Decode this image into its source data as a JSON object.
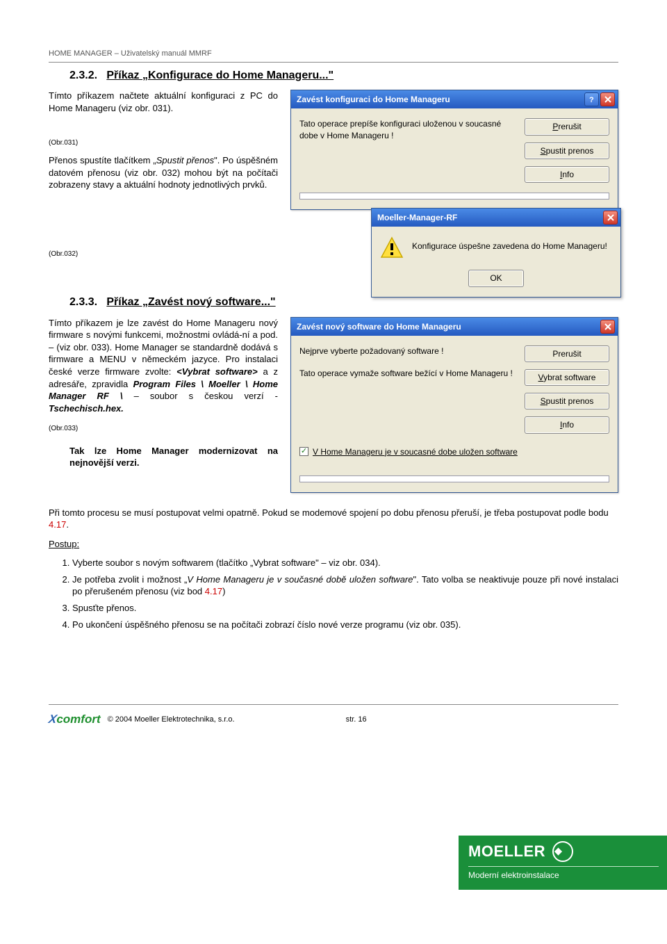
{
  "header": {
    "text": "HOME MANAGER – Uživatelský manuál  MMRF"
  },
  "s1": {
    "num": "2.3.2.",
    "title": "Příkaz „Konfigurace do Home Manageru...\"",
    "p1": "Tímto příkazem načtete aktuální konfiguraci z PC do Home Manageru (viz obr. 031).",
    "capt031": "(Obr.031)",
    "p2a": "Přenos spustíte tlačítkem „",
    "p2b": "Spustit přenos",
    "p2c": "\". Po úspěšném datovém přenosu (viz obr. 032) mohou být na počítači zobrazeny stavy a aktuální hodnoty jednotlivých prvků.",
    "capt032": "(Obr.032)"
  },
  "dlg1": {
    "title": "Zavést konfiguraci do Home Manageru",
    "msg": "Tato operace prepíše konfiguraci uloženou v soucasné dobe v Home Manageru !",
    "btn_cancel": "Prerušit",
    "btn_start": "Spustit prenos",
    "btn_info": "Info"
  },
  "dlg2": {
    "title": "Moeller-Manager-RF",
    "msg": "Konfigurace úspešne zavedena do Home Manageru!",
    "ok": "OK"
  },
  "s2": {
    "num": "2.3.3.",
    "title": "Příkaz „Zavést nový software...\"",
    "p1": "Tímto příkazem je lze zavést do Home Manageru nový firmware s novými funkcemi, možnostmi ovládá-ní a pod. – (viz obr. 033). Home Manager se standardně dodává s firmware a MENU v německém jazyce. Pro instalaci české verze firmware zvolte: ",
    "p1b": "<Vybrat software>",
    "p1c": " a z adresáře, zpravidla ",
    "p1d": "Program Files \\ Moeller \\ Home Manager RF \\",
    "p1e": " – soubor s českou verzí - ",
    "p1f": "Tschechisch.hex.",
    "capt033": "(Obr.033)",
    "p2": "Tak lze Home Manager modernizovat na nejnovější verzi.",
    "p3a": "Při tomto procesu se musí postupovat velmi opatrně. Pokud se modemové spojení po dobu přenosu přeruší, je třeba postupovat podle bodu ",
    "p3b": "4.17",
    "p3c": ".",
    "postup": "Postup:",
    "li1": "Vyberte soubor s novým softwarem (tlačítko „Vybrat software\" – viz obr. 034).",
    "li2a": "Je potřeba zvolit i možnost „",
    "li2b": "V Home Manageru je v současné době uložen software",
    "li2c": "\". Tato volba se neaktivuje pouze  při nové instalaci po přerušeném přenosu (viz bod ",
    "li2d": "4.17",
    "li2e": ")",
    "li3": "Spusťte přenos.",
    "li4": "Po ukončení úspěšného přenosu se na počítači zobrazí číslo nové verze programu (viz obr. 035)."
  },
  "dlg3": {
    "title": "Zavést nový software do Home Manageru",
    "msg1": "Nejprve vyberte požadovaný software !",
    "msg2": "Tato operace vymaže software bežící v Home Manageru !",
    "btn_cancel": "Prerušit",
    "btn_select": "Vybrat software",
    "btn_start": "Spustit prenos",
    "btn_info": "Info",
    "checkbox": "V Home Manageru je v soucasné dobe uložen software"
  },
  "footer": {
    "brand1": "X",
    "brand2": "comfort",
    "copy": "© 2004 Moeller Elektrotechnika, s.r.o.",
    "page": "str. 16",
    "moeller": "MOELLER",
    "moeller_sub": "Moderní elektroinstalace"
  }
}
